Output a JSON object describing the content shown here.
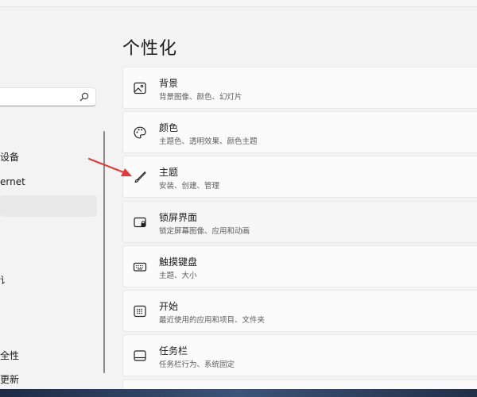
{
  "page": {
    "title": "个性化"
  },
  "search": {
    "placeholder": ""
  },
  "nav": {
    "items": [
      {
        "label": "设备"
      },
      {
        "label": "ernet"
      },
      {
        "label": ""
      },
      {
        "label": "讠"
      },
      {
        "label": "全性"
      },
      {
        "label": "更新"
      }
    ]
  },
  "cards": [
    {
      "title": "背景",
      "subtitle": "背景图像、颜色、幻灯片",
      "icon": "image-icon"
    },
    {
      "title": "颜色",
      "subtitle": "主题色、透明效果、颜色主题",
      "icon": "palette-icon"
    },
    {
      "title": "主题",
      "subtitle": "安装、创建、管理",
      "icon": "brush-icon"
    },
    {
      "title": "锁屏界面",
      "subtitle": "锁定屏幕图像、应用和动画",
      "icon": "lock-screen-icon"
    },
    {
      "title": "触摸键盘",
      "subtitle": "主题、大小",
      "icon": "keyboard-icon"
    },
    {
      "title": "开始",
      "subtitle": "最近使用的应用和项目、文件夹",
      "icon": "start-menu-icon"
    },
    {
      "title": "任务栏",
      "subtitle": "任务栏行为、系统固定",
      "icon": "taskbar-icon"
    }
  ],
  "colors": {
    "annotation_arrow": "#e53935",
    "accent": "#1a1a1a"
  }
}
